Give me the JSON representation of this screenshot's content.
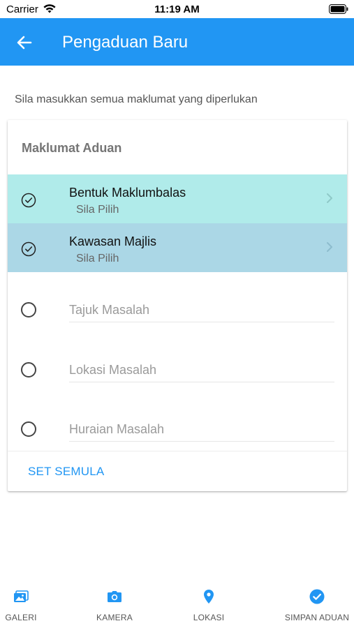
{
  "status_bar": {
    "carrier": "Carrier",
    "time": "11:19 AM",
    "icons": [
      "wifi-icon",
      "battery-icon"
    ]
  },
  "app_bar": {
    "title": "Pengaduan Baru",
    "back_icon": "arrow-left-icon",
    "color": "#2196f3"
  },
  "instruction": "Sila masukkan semua maklumat yang diperlukan",
  "card": {
    "header": "Maklumat Aduan",
    "select_rows": [
      {
        "title": "Bentuk Maklumbalas",
        "subtitle": "Sila Pilih",
        "background": "#b0ebea",
        "icon": "check-circle-icon"
      },
      {
        "title": "Kawasan Majlis",
        "subtitle": "Sila Pilih",
        "background": "#abd7e6",
        "icon": "check-circle-icon"
      }
    ],
    "fields": [
      {
        "placeholder": "Tajuk Masalah",
        "value": ""
      },
      {
        "placeholder": "Lokasi Masalah",
        "value": ""
      },
      {
        "placeholder": "Huraian Masalah",
        "value": ""
      }
    ],
    "reset_label": "SET SEMULA"
  },
  "bottom_nav": {
    "items": [
      {
        "label": "GALERI",
        "icon": "gallery-icon"
      },
      {
        "label": "KAMERA",
        "icon": "camera-icon"
      },
      {
        "label": "LOKASI",
        "icon": "location-pin-icon"
      },
      {
        "label": "SIMPAN ADUAN",
        "icon": "check-circle-filled-icon"
      }
    ],
    "icon_color": "#2196f3"
  }
}
